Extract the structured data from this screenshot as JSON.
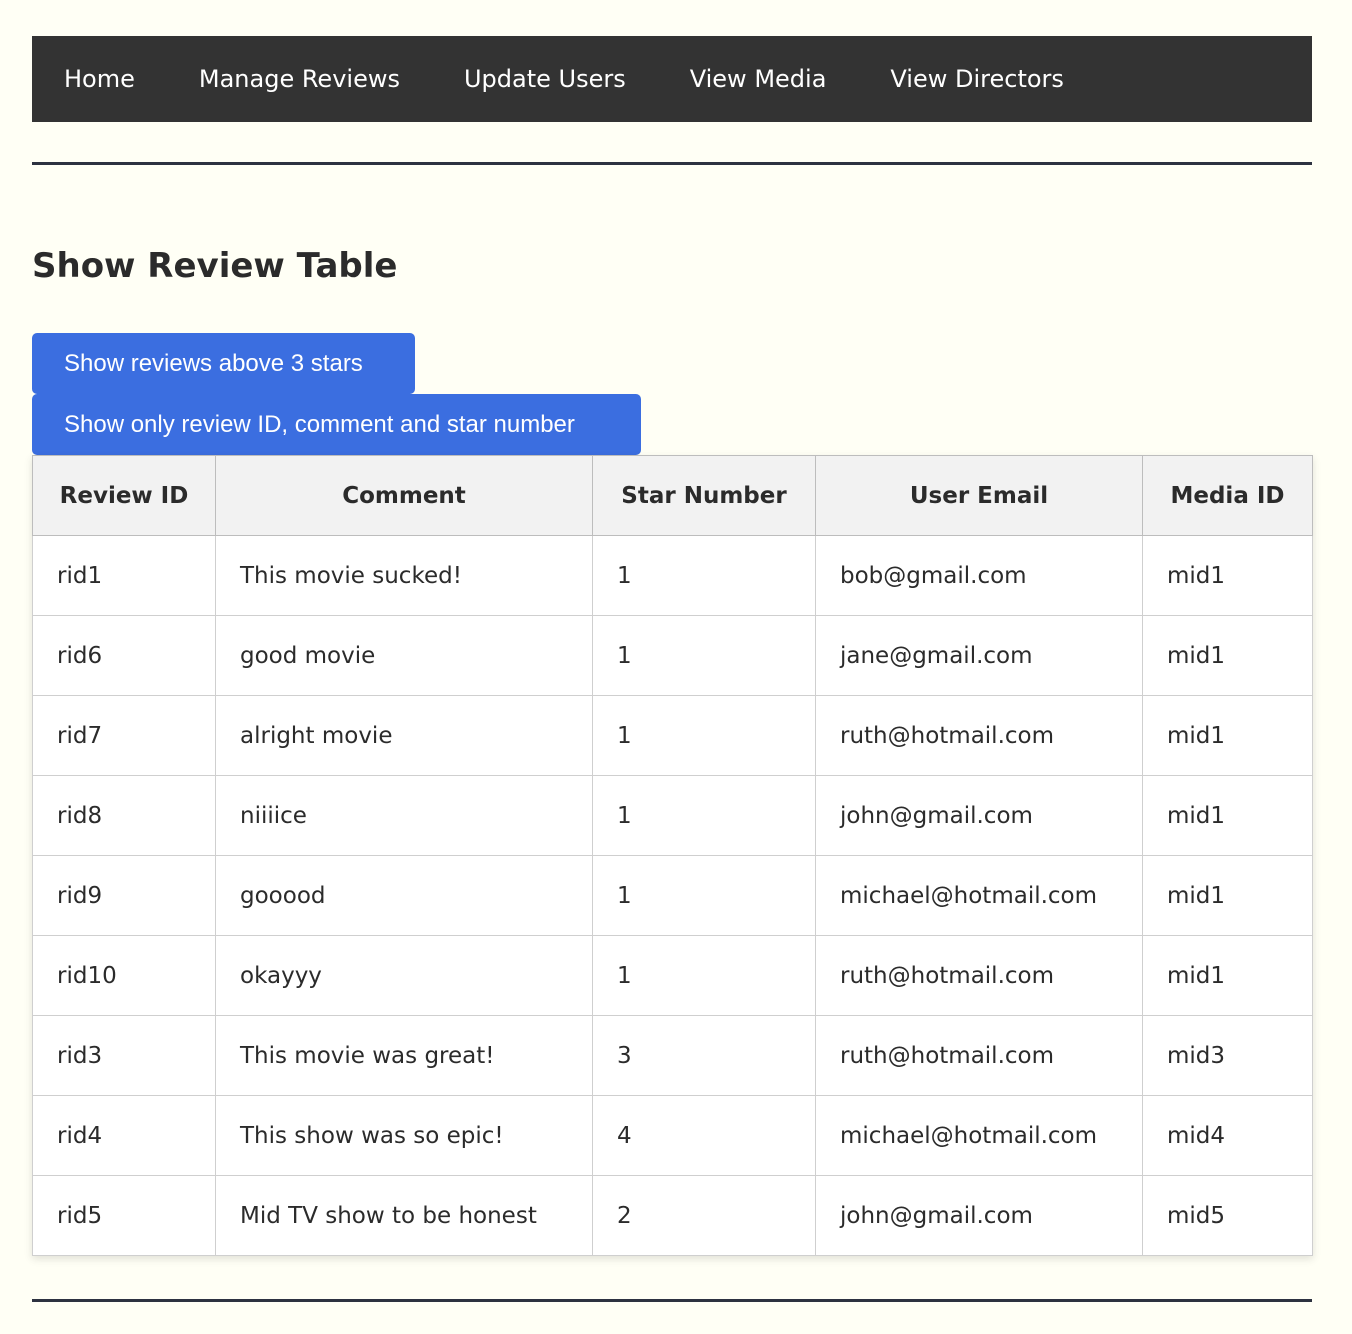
{
  "nav": {
    "items": [
      {
        "label": "Home"
      },
      {
        "label": "Manage Reviews"
      },
      {
        "label": "Update Users"
      },
      {
        "label": "View Media"
      },
      {
        "label": "View Directors"
      }
    ]
  },
  "page": {
    "title": "Show Review Table"
  },
  "actions": {
    "above_three": "Show reviews above 3 stars",
    "only_fields": "Show only review ID, comment and star number"
  },
  "table": {
    "headers": [
      "Review ID",
      "Comment",
      "Star Number",
      "User Email",
      "Media ID"
    ],
    "rows": [
      [
        "rid1",
        "This movie sucked!",
        "1",
        "bob@gmail.com",
        "mid1"
      ],
      [
        "rid6",
        "good movie",
        "1",
        "jane@gmail.com",
        "mid1"
      ],
      [
        "rid7",
        "alright movie",
        "1",
        "ruth@hotmail.com",
        "mid1"
      ],
      [
        "rid8",
        "niiiice",
        "1",
        "john@gmail.com",
        "mid1"
      ],
      [
        "rid9",
        "gooood",
        "1",
        "michael@hotmail.com",
        "mid1"
      ],
      [
        "rid10",
        "okayyy",
        "1",
        "ruth@hotmail.com",
        "mid1"
      ],
      [
        "rid3",
        "This movie was great!",
        "3",
        "ruth@hotmail.com",
        "mid3"
      ],
      [
        "rid4",
        "This show was so epic!",
        "4",
        "michael@hotmail.com",
        "mid4"
      ],
      [
        "rid5",
        "Mid TV show to be honest",
        "2",
        "john@gmail.com",
        "mid5"
      ]
    ]
  },
  "colors": {
    "nav_bg": "#333333",
    "accent": "#3b6ee0",
    "page_bg": "#fffff5"
  }
}
